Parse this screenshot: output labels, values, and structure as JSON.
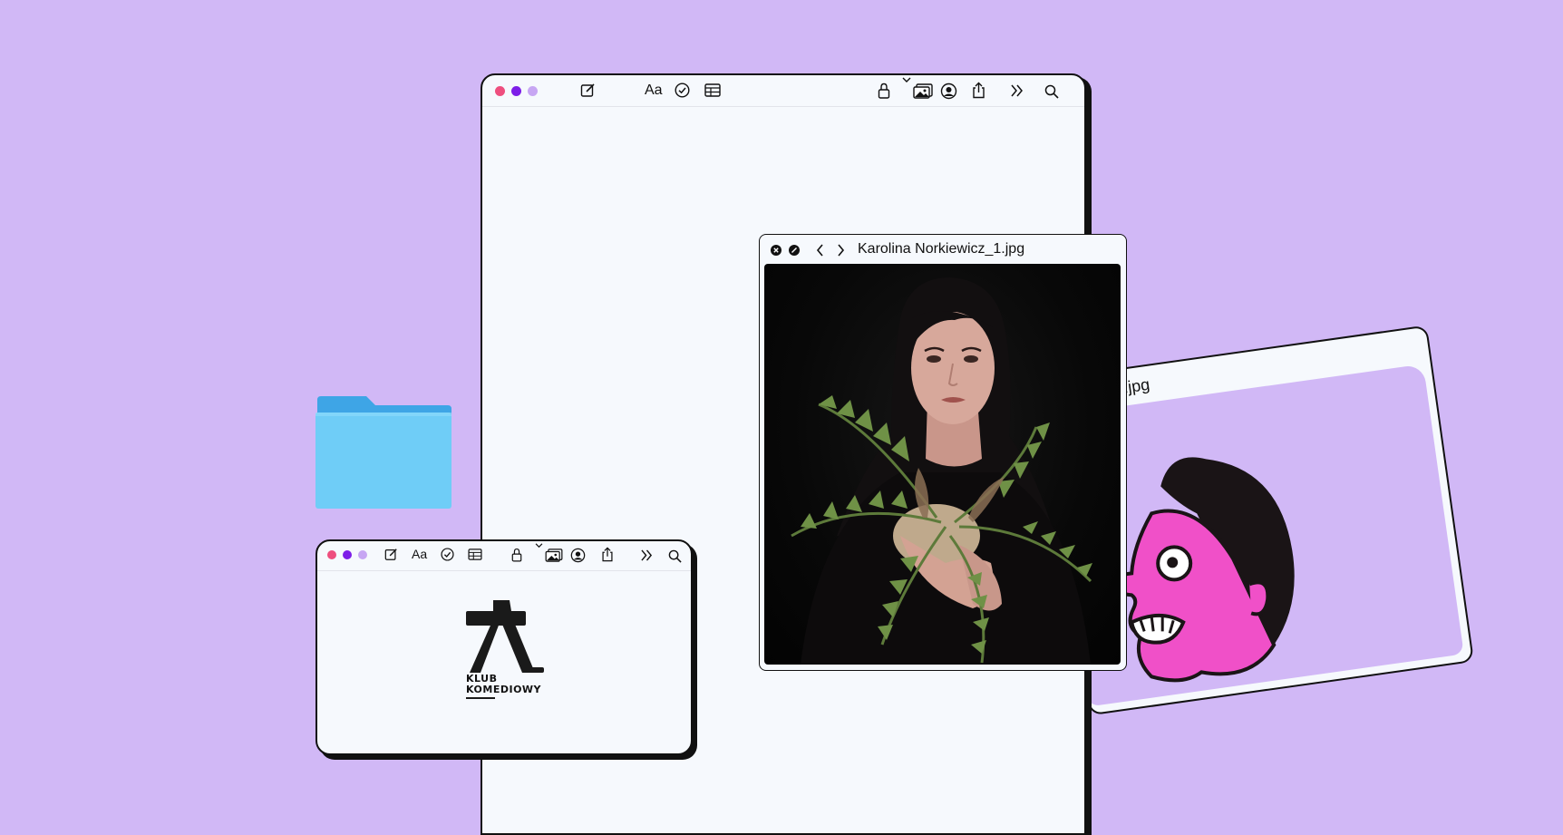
{
  "main_window": {
    "traffic_lights": [
      {
        "name": "close-dot",
        "color": "#ee4e7e"
      },
      {
        "name": "minimize-dot",
        "color": "#7d1ee8"
      },
      {
        "name": "zoom-dot",
        "color": "#c7a6f3"
      }
    ],
    "toolbar": {
      "font_label": "Aa",
      "icons": [
        "compose-icon",
        "font-icon",
        "checklist-icon",
        "table-icon",
        "lock-icon",
        "chevron-down-icon",
        "media-icon",
        "collaborate-icon",
        "share-icon",
        "more-icon",
        "search-icon"
      ]
    }
  },
  "small_window": {
    "font_label": "Aa",
    "logo_line1": "KLUB",
    "logo_line2": "KOMEDIOWY"
  },
  "viewer": {
    "title": "Karolina Norkiewicz_1.jpg",
    "icons": [
      "close-circle-icon",
      "fullscreen-circle-icon",
      "back-arrow-icon",
      "forward-arrow-icon"
    ]
  },
  "back_window": {
    "title": "ap_final.jpg"
  },
  "colors": {
    "background": "#d1b8f6",
    "window": "#f6f9fd",
    "folder_top": "#3ea5e6",
    "folder_body": "#6fcdf7",
    "cartoon_pink": "#f050c8"
  }
}
